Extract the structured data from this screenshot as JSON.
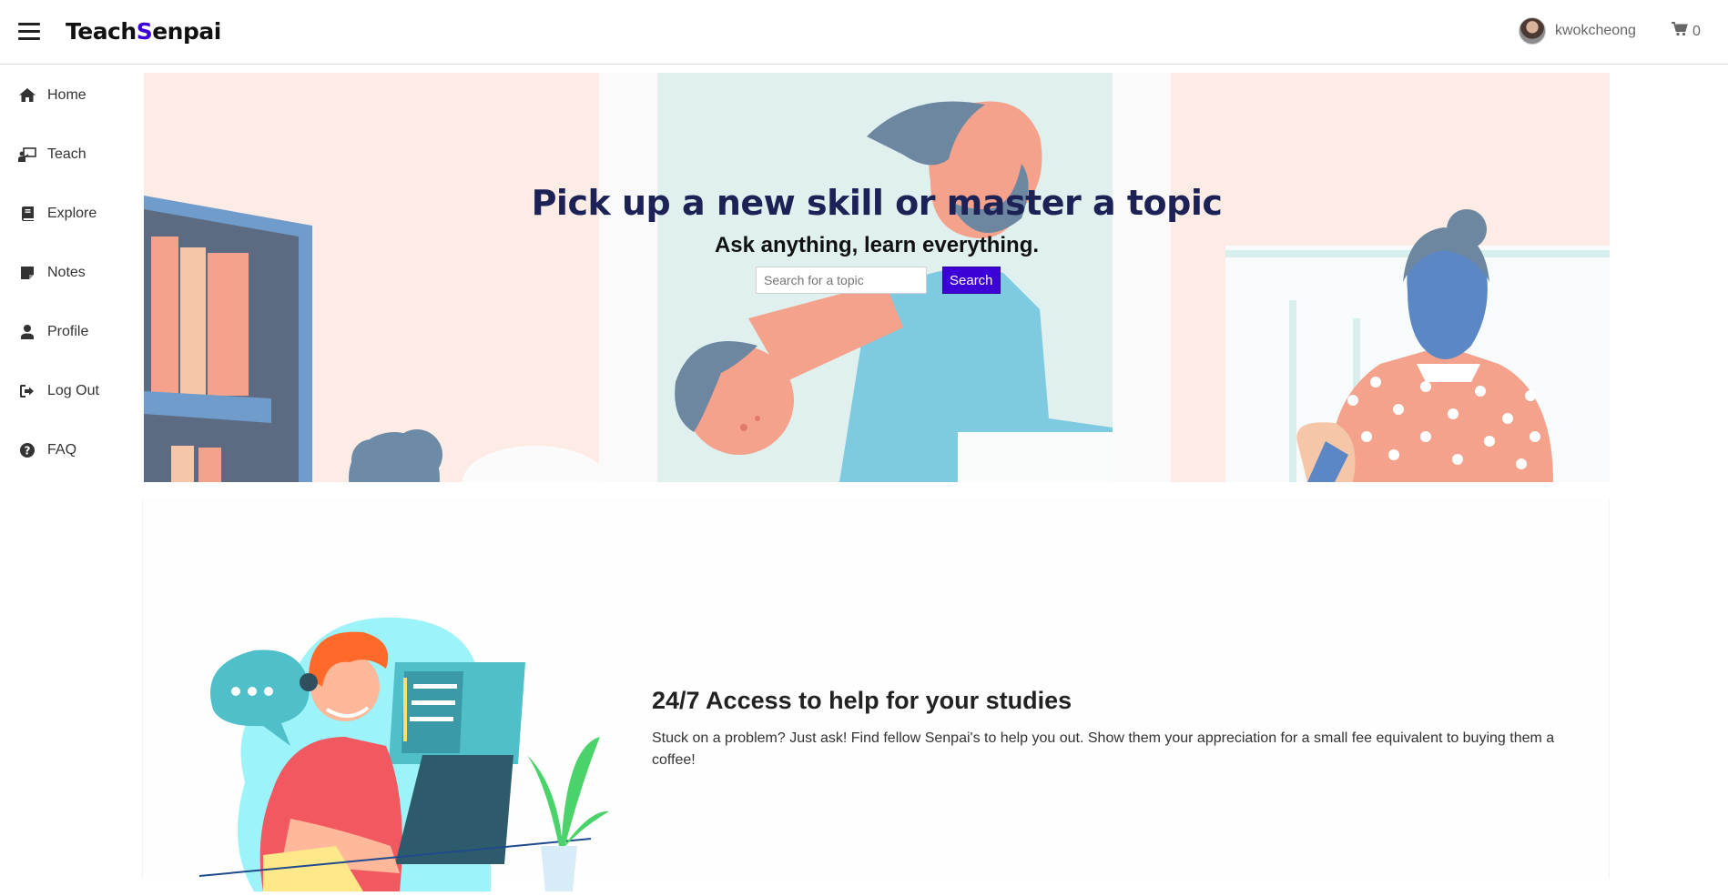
{
  "header": {
    "brand_prefix": "Teach",
    "brand_highlight": "S",
    "brand_suffix": "enpai",
    "username": "kwokcheong",
    "cart_count": "0"
  },
  "sidebar": {
    "items": [
      {
        "label": "Home",
        "icon": "home-icon"
      },
      {
        "label": "Teach",
        "icon": "teach-icon"
      },
      {
        "label": "Explore",
        "icon": "book-icon"
      },
      {
        "label": "Notes",
        "icon": "note-icon"
      },
      {
        "label": "Profile",
        "icon": "user-icon"
      },
      {
        "label": "Log Out",
        "icon": "sign-out-icon"
      },
      {
        "label": "FAQ",
        "icon": "question-circle-icon"
      }
    ]
  },
  "hero": {
    "title": "Pick up a new skill or master a topic",
    "subtitle": "Ask anything, learn everything.",
    "search_placeholder": "Search for a topic",
    "search_value": "",
    "search_button": "Search"
  },
  "feature": {
    "title": "24/7 Access to help for your studies",
    "text": "Stuck on a problem? Just ask! Find fellow Senpai's to help you out. Show them your appreciation for a small fee equivalent to buying them a coffee!"
  },
  "colors": {
    "brand_accent": "#3d00d6",
    "hero_title": "#1c2256",
    "panel_peach": "#fdece6",
    "panel_mint": "#dff0ef"
  }
}
